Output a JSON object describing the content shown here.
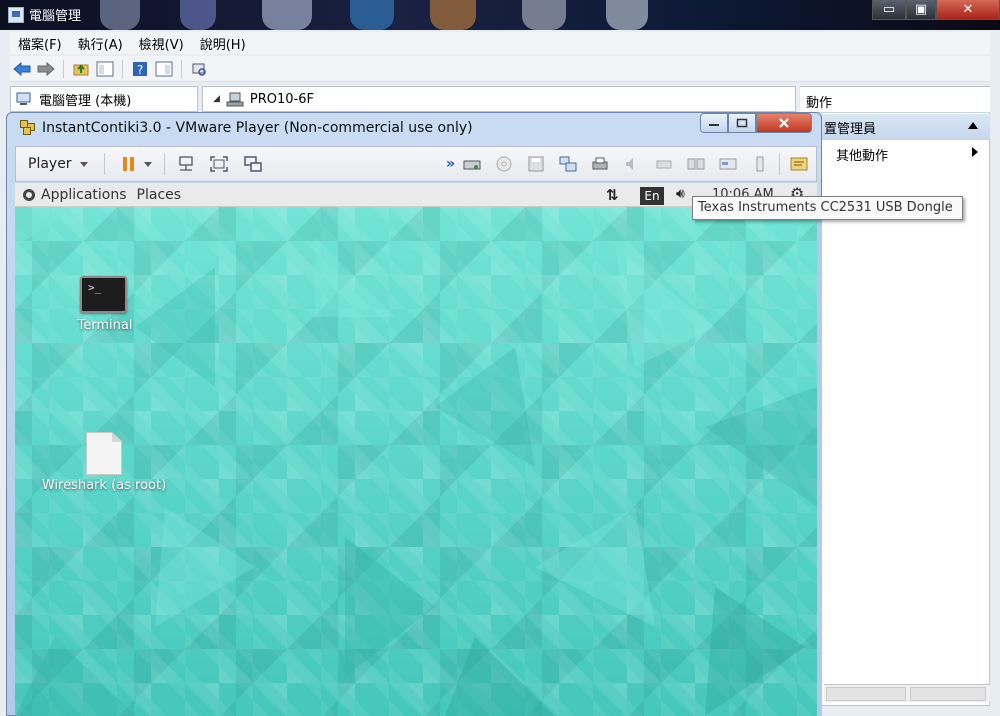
{
  "outer_window": {
    "title": "電腦管理",
    "controls": {
      "minimize": "▭",
      "maximize": "▣",
      "close": "✕"
    },
    "menu": [
      "檔案(F)",
      "執行(A)",
      "檢視(V)",
      "說明(H)"
    ],
    "tree_root": "電腦管理 (本機)",
    "computer_node": "PRO10-6F",
    "actions_header": "動作",
    "actions_section": "置管理員",
    "actions_more": "其他動作"
  },
  "vmware": {
    "title": "InstantContiki3.0 - VMware Player (Non-commercial use only)",
    "player_menu": "Player",
    "more_glyph": "»"
  },
  "guest": {
    "applications": "Applications",
    "places": "Places",
    "language": "En",
    "clock": "10:06 AM",
    "desktop_icons": [
      {
        "label": "Terminal",
        "glyph": ">_"
      },
      {
        "label": "Wireshark (as root)"
      }
    ]
  },
  "tooltip": "Texas Instruments CC2531 USB Dongle",
  "icons": {
    "back": "back-arrow-icon",
    "forward": "forward-arrow-icon",
    "net": "network-arrows-icon",
    "volume": "volume-icon",
    "gear": "settings-gear-icon"
  }
}
